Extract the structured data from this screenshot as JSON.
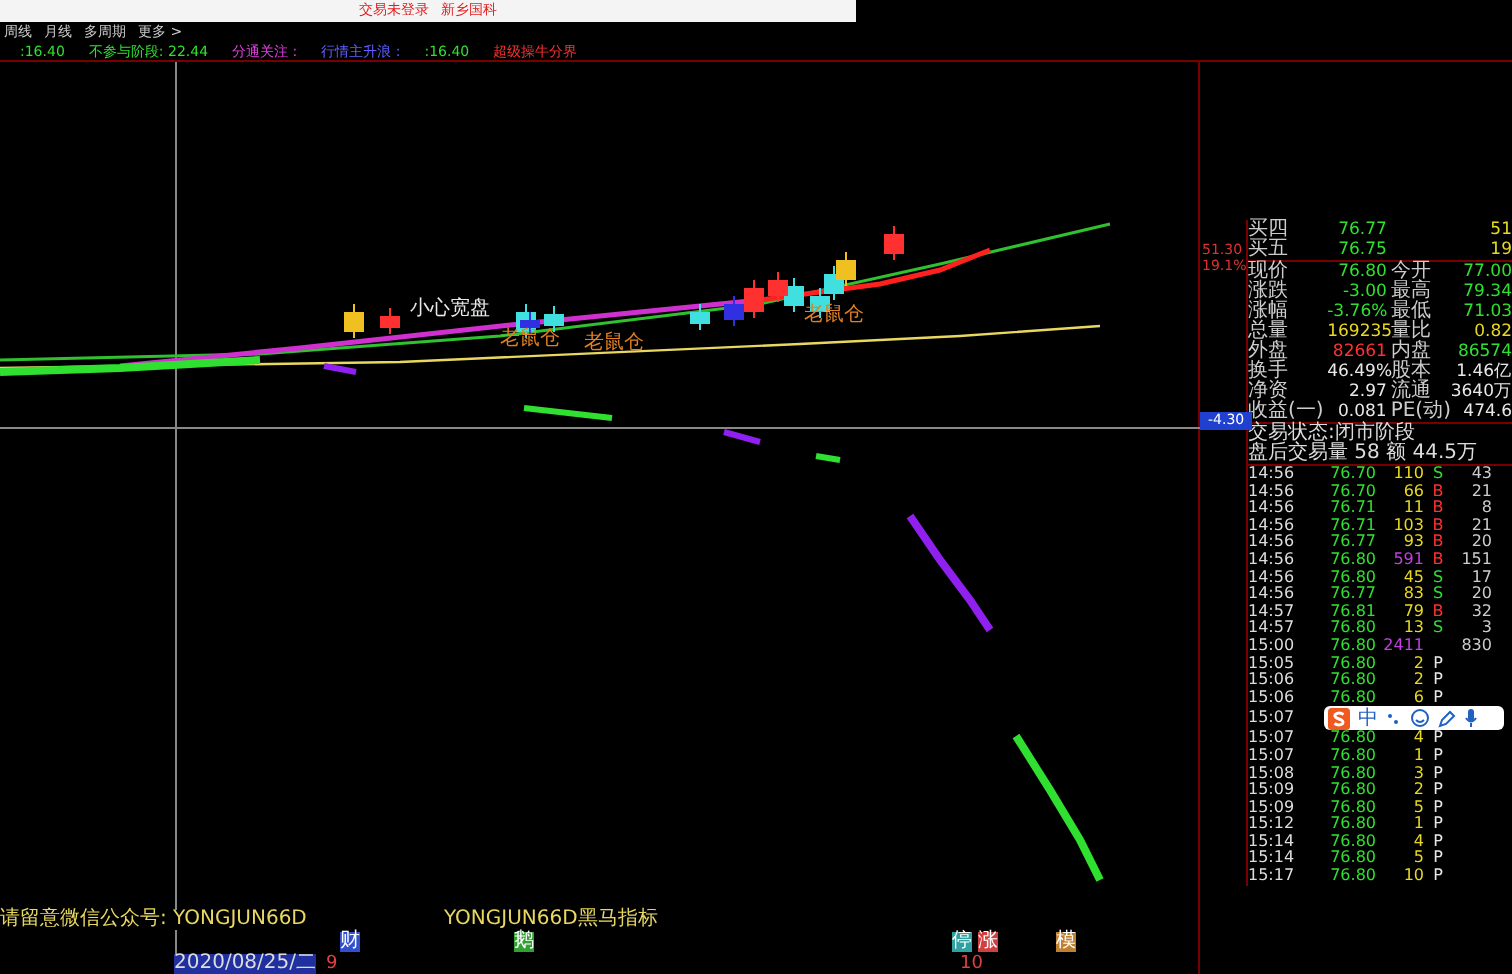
{
  "title_bar": {
    "title": "交易未登录",
    "subtitle": "新乡国科"
  },
  "menu": [
    "周线",
    "月线",
    "多周期",
    "更多 >"
  ],
  "indicator_line": [
    {
      "text": ":16.40",
      "color": "#30e030"
    },
    {
      "text": "不参与阶段: 22.44",
      "color": "#30e030"
    },
    {
      "text": "分通关注 :",
      "color": "#e040e0"
    },
    {
      "text": "行情主升浪 :",
      "color": "#6060ff"
    },
    {
      "text": ":16.40",
      "color": "#30e030"
    },
    {
      "text": "超级操牛分界",
      "color": "#ff3030"
    }
  ],
  "chart": {
    "labels": [
      "小心宽盘",
      "老鼠仓",
      "老鼠仓",
      "老鼠仓"
    ]
  },
  "price_axis": {
    "high": "51.30",
    "high_pct": "19.1%",
    "cursor": "-4.30"
  },
  "order_book": [
    {
      "label": "买四",
      "price": "76.77",
      "volume": "51"
    },
    {
      "label": "买五",
      "price": "76.75",
      "volume": "19"
    }
  ],
  "quote": [
    {
      "label": "现价",
      "value": "76.80",
      "color": "#30e030"
    },
    {
      "label": "今开",
      "value": "77.00",
      "color": "#30e030"
    },
    {
      "label": "涨跌",
      "value": "-3.00",
      "color": "#30e030"
    },
    {
      "label": "最高",
      "value": "79.34",
      "color": "#30e030"
    },
    {
      "label": "涨幅",
      "value": "-3.76%",
      "color": "#30e030"
    },
    {
      "label": "最低",
      "value": "71.03",
      "color": "#30e030"
    },
    {
      "label": "总量",
      "value": "169235",
      "color": "#e8d820"
    },
    {
      "label": "量比",
      "value": "0.82",
      "color": "#e8d820"
    },
    {
      "label": "外盘",
      "value": "82661",
      "color": "#ff3030"
    },
    {
      "label": "内盘",
      "value": "86574",
      "color": "#30e030"
    },
    {
      "label": "换手",
      "value": "46.49%",
      "color": "#e8e8e8"
    },
    {
      "label": "股本",
      "value": "1.46亿",
      "color": "#e8e8e8"
    },
    {
      "label": "净资",
      "value": "2.97",
      "color": "#e8e8e8"
    },
    {
      "label": "流通",
      "value": "3640万",
      "color": "#e8e8e8"
    },
    {
      "label": "收益(一)",
      "value": "0.081",
      "color": "#e8e8e8"
    },
    {
      "label": "PE(动)",
      "value": "474.6",
      "color": "#e8e8e8"
    }
  ],
  "status": {
    "trade_state": "交易状态:闭市阶段",
    "after_hours": "盘后交易量 58 额 44.5万"
  },
  "ticks": [
    {
      "time": "14:56",
      "price": "76.70",
      "volume": "110",
      "side": "S",
      "kind": "sell",
      "highlight": false,
      "last": "43"
    },
    {
      "time": "14:56",
      "price": "76.70",
      "volume": "66",
      "side": "B",
      "kind": "buy",
      "highlight": false,
      "last": "21"
    },
    {
      "time": "14:56",
      "price": "76.71",
      "volume": "11",
      "side": "B",
      "kind": "buy",
      "highlight": false,
      "last": "8"
    },
    {
      "time": "14:56",
      "price": "76.71",
      "volume": "103",
      "side": "B",
      "kind": "buy",
      "highlight": false,
      "last": "21"
    },
    {
      "time": "14:56",
      "price": "76.77",
      "volume": "93",
      "side": "B",
      "kind": "buy",
      "highlight": false,
      "last": "20"
    },
    {
      "time": "14:56",
      "price": "76.80",
      "volume": "591",
      "side": "B",
      "kind": "buy",
      "highlight": true,
      "last": "151"
    },
    {
      "time": "14:56",
      "price": "76.80",
      "volume": "45",
      "side": "S",
      "kind": "sell",
      "highlight": false,
      "last": "17"
    },
    {
      "time": "14:56",
      "price": "76.77",
      "volume": "83",
      "side": "S",
      "kind": "sell",
      "highlight": false,
      "last": "20"
    },
    {
      "time": "14:57",
      "price": "76.81",
      "volume": "79",
      "side": "B",
      "kind": "buy",
      "highlight": false,
      "last": "32"
    },
    {
      "time": "14:57",
      "price": "76.80",
      "volume": "13",
      "side": "S",
      "kind": "sell",
      "highlight": false,
      "last": "3"
    },
    {
      "time": "15:00",
      "price": "76.80",
      "volume": "2411",
      "kind": "none",
      "highlight": true,
      "last": "830"
    },
    {
      "time": "15:05",
      "price": "76.80",
      "volume": "2",
      "side": "P",
      "kind": "pass",
      "highlight": false
    },
    {
      "time": "15:06",
      "price": "76.80",
      "volume": "2",
      "side": "P",
      "kind": "pass",
      "highlight": false
    },
    {
      "time": "15:06",
      "price": "76.80",
      "volume": "6",
      "side": "P",
      "kind": "pass",
      "highlight": false
    },
    {
      "time": "15:07",
      "kind": "covered"
    },
    {
      "time": "15:07",
      "price": "76.80",
      "volume": "4",
      "side": "P",
      "kind": "pass",
      "highlight": false
    },
    {
      "time": "15:07",
      "price": "76.80",
      "volume": "1",
      "side": "P",
      "kind": "pass",
      "highlight": false
    },
    {
      "time": "15:08",
      "price": "76.80",
      "volume": "3",
      "side": "P",
      "kind": "pass",
      "highlight": false
    },
    {
      "time": "15:09",
      "price": "76.80",
      "volume": "2",
      "side": "P",
      "kind": "pass",
      "highlight": false
    },
    {
      "time": "15:09",
      "price": "76.80",
      "volume": "5",
      "side": "P",
      "kind": "pass",
      "highlight": false
    },
    {
      "time": "15:12",
      "price": "76.80",
      "volume": "1",
      "side": "P",
      "kind": "pass",
      "highlight": false
    },
    {
      "time": "15:14",
      "price": "76.80",
      "volume": "4",
      "side": "P",
      "kind": "pass",
      "highlight": false
    },
    {
      "time": "15:14",
      "price": "76.80",
      "volume": "5",
      "side": "P",
      "kind": "pass",
      "highlight": false
    },
    {
      "time": "15:17",
      "price": "76.80",
      "volume": "10",
      "side": "P",
      "kind": "pass",
      "highlight": false
    }
  ],
  "ime_toolbar": {
    "mode": "中"
  },
  "bottom": {
    "notice": "请留意微信公众号: YONGJUN66D",
    "indicator_name": "YONGJUN66D黑马指标",
    "markers": [
      {
        "text": "财",
        "color": "#3050d0"
      },
      {
        "text": "鹅",
        "color": "#30a030"
      },
      {
        "text": "停",
        "color": "#30a0a0"
      },
      {
        "text": "涨",
        "color": "#d04040"
      },
      {
        "text": "模",
        "color": "#c08030"
      }
    ],
    "date": "2020/08/25/二",
    "day_ticks": [
      "9",
      "10"
    ]
  }
}
